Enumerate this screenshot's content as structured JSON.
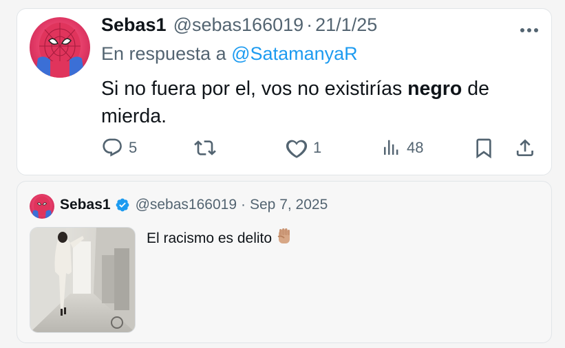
{
  "tweet": {
    "name": "Sebas1",
    "handle": "@sebas166019",
    "separator": "·",
    "date": "21/1/25",
    "reply_prefix": "En respuesta a",
    "reply_to": "@SatamanyaR",
    "text_before": "Si no fuera por el, vos no existirías",
    "text_bold": "negro",
    "text_after": "de mierda.",
    "avatar_icon": "spiderman-avatar",
    "actions": {
      "replies": "5",
      "retweets": "",
      "likes": "1",
      "views": "48"
    }
  },
  "quote": {
    "name": "Sebas1",
    "verified": true,
    "handle": "@sebas166019",
    "separator": "·",
    "date": "Sep 7, 2025",
    "text": "El racismo es delito",
    "emoji": "raised-fist-emoji"
  },
  "colors": {
    "accent": "#1d9bf0",
    "muted": "#536471",
    "text": "#0f1419"
  }
}
